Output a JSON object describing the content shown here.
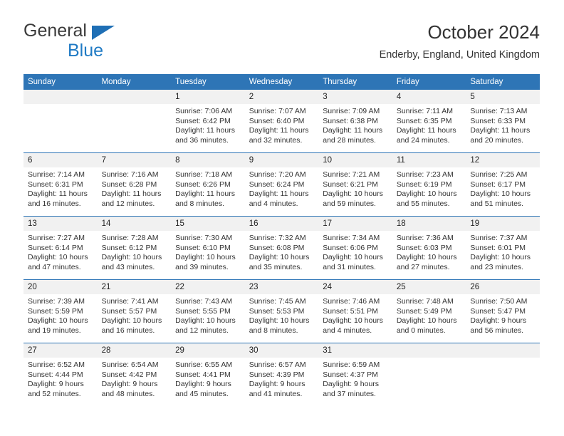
{
  "brand": {
    "name_part1": "General",
    "name_part2": "Blue",
    "triangle_color": "#1f6fb5",
    "blue_color": "#1f7ac4"
  },
  "header": {
    "title": "October 2024",
    "subtitle": "Enderby, England, United Kingdom",
    "header_bg_color": "#2e75b6",
    "daynum_bg_color": "#f1f1f1"
  },
  "weekday_headers": [
    "Sunday",
    "Monday",
    "Tuesday",
    "Wednesday",
    "Thursday",
    "Friday",
    "Saturday"
  ],
  "weeks": [
    [
      {
        "day": "",
        "empty": true,
        "sunrise": "",
        "sunset": "",
        "daylight1": "",
        "daylight2": ""
      },
      {
        "day": "",
        "empty": true,
        "sunrise": "",
        "sunset": "",
        "daylight1": "",
        "daylight2": ""
      },
      {
        "day": "1",
        "sunrise": "Sunrise: 7:06 AM",
        "sunset": "Sunset: 6:42 PM",
        "daylight1": "Daylight: 11 hours",
        "daylight2": "and 36 minutes."
      },
      {
        "day": "2",
        "sunrise": "Sunrise: 7:07 AM",
        "sunset": "Sunset: 6:40 PM",
        "daylight1": "Daylight: 11 hours",
        "daylight2": "and 32 minutes."
      },
      {
        "day": "3",
        "sunrise": "Sunrise: 7:09 AM",
        "sunset": "Sunset: 6:38 PM",
        "daylight1": "Daylight: 11 hours",
        "daylight2": "and 28 minutes."
      },
      {
        "day": "4",
        "sunrise": "Sunrise: 7:11 AM",
        "sunset": "Sunset: 6:35 PM",
        "daylight1": "Daylight: 11 hours",
        "daylight2": "and 24 minutes."
      },
      {
        "day": "5",
        "sunrise": "Sunrise: 7:13 AM",
        "sunset": "Sunset: 6:33 PM",
        "daylight1": "Daylight: 11 hours",
        "daylight2": "and 20 minutes."
      }
    ],
    [
      {
        "day": "6",
        "sunrise": "Sunrise: 7:14 AM",
        "sunset": "Sunset: 6:31 PM",
        "daylight1": "Daylight: 11 hours",
        "daylight2": "and 16 minutes."
      },
      {
        "day": "7",
        "sunrise": "Sunrise: 7:16 AM",
        "sunset": "Sunset: 6:28 PM",
        "daylight1": "Daylight: 11 hours",
        "daylight2": "and 12 minutes."
      },
      {
        "day": "8",
        "sunrise": "Sunrise: 7:18 AM",
        "sunset": "Sunset: 6:26 PM",
        "daylight1": "Daylight: 11 hours",
        "daylight2": "and 8 minutes."
      },
      {
        "day": "9",
        "sunrise": "Sunrise: 7:20 AM",
        "sunset": "Sunset: 6:24 PM",
        "daylight1": "Daylight: 11 hours",
        "daylight2": "and 4 minutes."
      },
      {
        "day": "10",
        "sunrise": "Sunrise: 7:21 AM",
        "sunset": "Sunset: 6:21 PM",
        "daylight1": "Daylight: 10 hours",
        "daylight2": "and 59 minutes."
      },
      {
        "day": "11",
        "sunrise": "Sunrise: 7:23 AM",
        "sunset": "Sunset: 6:19 PM",
        "daylight1": "Daylight: 10 hours",
        "daylight2": "and 55 minutes."
      },
      {
        "day": "12",
        "sunrise": "Sunrise: 7:25 AM",
        "sunset": "Sunset: 6:17 PM",
        "daylight1": "Daylight: 10 hours",
        "daylight2": "and 51 minutes."
      }
    ],
    [
      {
        "day": "13",
        "sunrise": "Sunrise: 7:27 AM",
        "sunset": "Sunset: 6:14 PM",
        "daylight1": "Daylight: 10 hours",
        "daylight2": "and 47 minutes."
      },
      {
        "day": "14",
        "sunrise": "Sunrise: 7:28 AM",
        "sunset": "Sunset: 6:12 PM",
        "daylight1": "Daylight: 10 hours",
        "daylight2": "and 43 minutes."
      },
      {
        "day": "15",
        "sunrise": "Sunrise: 7:30 AM",
        "sunset": "Sunset: 6:10 PM",
        "daylight1": "Daylight: 10 hours",
        "daylight2": "and 39 minutes."
      },
      {
        "day": "16",
        "sunrise": "Sunrise: 7:32 AM",
        "sunset": "Sunset: 6:08 PM",
        "daylight1": "Daylight: 10 hours",
        "daylight2": "and 35 minutes."
      },
      {
        "day": "17",
        "sunrise": "Sunrise: 7:34 AM",
        "sunset": "Sunset: 6:06 PM",
        "daylight1": "Daylight: 10 hours",
        "daylight2": "and 31 minutes."
      },
      {
        "day": "18",
        "sunrise": "Sunrise: 7:36 AM",
        "sunset": "Sunset: 6:03 PM",
        "daylight1": "Daylight: 10 hours",
        "daylight2": "and 27 minutes."
      },
      {
        "day": "19",
        "sunrise": "Sunrise: 7:37 AM",
        "sunset": "Sunset: 6:01 PM",
        "daylight1": "Daylight: 10 hours",
        "daylight2": "and 23 minutes."
      }
    ],
    [
      {
        "day": "20",
        "sunrise": "Sunrise: 7:39 AM",
        "sunset": "Sunset: 5:59 PM",
        "daylight1": "Daylight: 10 hours",
        "daylight2": "and 19 minutes."
      },
      {
        "day": "21",
        "sunrise": "Sunrise: 7:41 AM",
        "sunset": "Sunset: 5:57 PM",
        "daylight1": "Daylight: 10 hours",
        "daylight2": "and 16 minutes."
      },
      {
        "day": "22",
        "sunrise": "Sunrise: 7:43 AM",
        "sunset": "Sunset: 5:55 PM",
        "daylight1": "Daylight: 10 hours",
        "daylight2": "and 12 minutes."
      },
      {
        "day": "23",
        "sunrise": "Sunrise: 7:45 AM",
        "sunset": "Sunset: 5:53 PM",
        "daylight1": "Daylight: 10 hours",
        "daylight2": "and 8 minutes."
      },
      {
        "day": "24",
        "sunrise": "Sunrise: 7:46 AM",
        "sunset": "Sunset: 5:51 PM",
        "daylight1": "Daylight: 10 hours",
        "daylight2": "and 4 minutes."
      },
      {
        "day": "25",
        "sunrise": "Sunrise: 7:48 AM",
        "sunset": "Sunset: 5:49 PM",
        "daylight1": "Daylight: 10 hours",
        "daylight2": "and 0 minutes."
      },
      {
        "day": "26",
        "sunrise": "Sunrise: 7:50 AM",
        "sunset": "Sunset: 5:47 PM",
        "daylight1": "Daylight: 9 hours",
        "daylight2": "and 56 minutes."
      }
    ],
    [
      {
        "day": "27",
        "sunrise": "Sunrise: 6:52 AM",
        "sunset": "Sunset: 4:44 PM",
        "daylight1": "Daylight: 9 hours",
        "daylight2": "and 52 minutes."
      },
      {
        "day": "28",
        "sunrise": "Sunrise: 6:54 AM",
        "sunset": "Sunset: 4:42 PM",
        "daylight1": "Daylight: 9 hours",
        "daylight2": "and 48 minutes."
      },
      {
        "day": "29",
        "sunrise": "Sunrise: 6:55 AM",
        "sunset": "Sunset: 4:41 PM",
        "daylight1": "Daylight: 9 hours",
        "daylight2": "and 45 minutes."
      },
      {
        "day": "30",
        "sunrise": "Sunrise: 6:57 AM",
        "sunset": "Sunset: 4:39 PM",
        "daylight1": "Daylight: 9 hours",
        "daylight2": "and 41 minutes."
      },
      {
        "day": "31",
        "sunrise": "Sunrise: 6:59 AM",
        "sunset": "Sunset: 4:37 PM",
        "daylight1": "Daylight: 9 hours",
        "daylight2": "and 37 minutes."
      },
      {
        "day": "",
        "empty": true,
        "sunrise": "",
        "sunset": "",
        "daylight1": "",
        "daylight2": ""
      },
      {
        "day": "",
        "empty": true,
        "sunrise": "",
        "sunset": "",
        "daylight1": "",
        "daylight2": ""
      }
    ]
  ]
}
